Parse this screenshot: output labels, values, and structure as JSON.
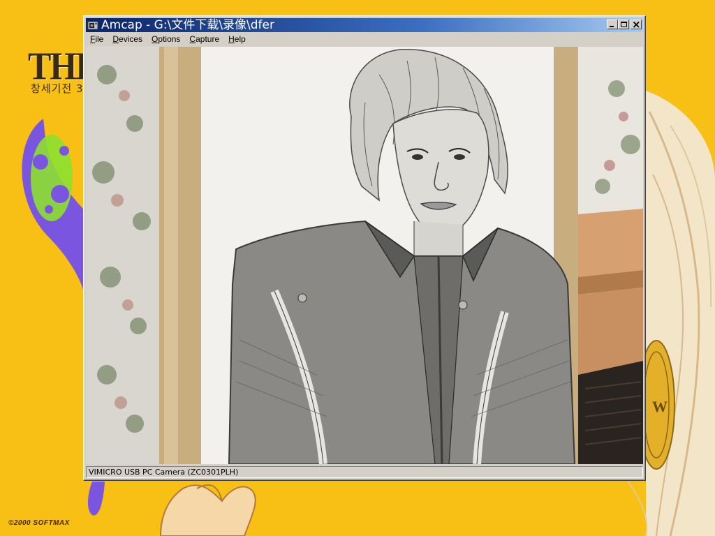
{
  "wallpaper": {
    "title": "THE W",
    "subtitle": "창세기전 3",
    "copyright": "©2000 SOFTMAX"
  },
  "window": {
    "title": "Amcap - G:\\文件下载\\录像\\dfer",
    "caption_buttons": {
      "minimize_icon": "minimize-icon",
      "maximize_icon": "maximize-icon",
      "close_icon": "close-icon"
    },
    "menu": [
      {
        "label": "File",
        "mnemonic": "F"
      },
      {
        "label": "Devices",
        "mnemonic": "D"
      },
      {
        "label": "Options",
        "mnemonic": "O"
      },
      {
        "label": "Capture",
        "mnemonic": "C"
      },
      {
        "label": "Help",
        "mnemonic": "H"
      }
    ],
    "status_text": "VIMICRO USB PC Camera (ZC0301PLH)"
  },
  "colors": {
    "desktop": "#f8bf14",
    "titlebar_start": "#0a246a",
    "titlebar_end": "#a6caf0",
    "window_face": "#d4d0c8",
    "wallpaper_purple": "#7a55e0",
    "wallpaper_green": "#8ce030"
  }
}
